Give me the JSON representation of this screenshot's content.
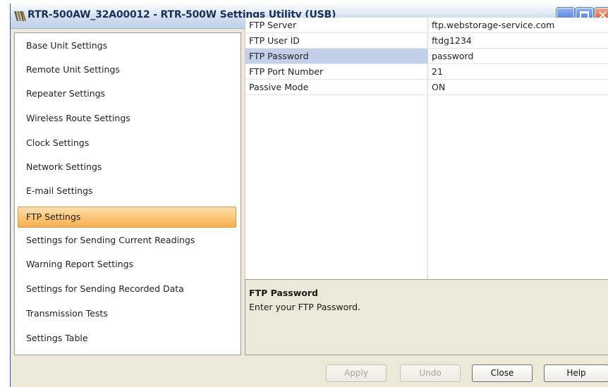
{
  "window": {
    "title": "RTR-500AW_32A00012 - RTR-500W Settings Utility (USB)",
    "controls": {
      "minimize": "minimize",
      "maximize": "maximize",
      "close_glyph": "✕"
    }
  },
  "sidebar": {
    "items": [
      {
        "label": "Base Unit Settings"
      },
      {
        "label": "Remote Unit Settings"
      },
      {
        "label": "Repeater Settings"
      },
      {
        "label": "Wireless Route Settings"
      },
      {
        "label": "Clock Settings"
      },
      {
        "label": "Network Settings"
      },
      {
        "label": "E-mail Settings"
      },
      {
        "label": "FTP Settings",
        "selected": true
      },
      {
        "label": "Settings for Sending Current Readings"
      },
      {
        "label": "Warning Report Settings"
      },
      {
        "label": "Settings for Sending Recorded Data"
      },
      {
        "label": "Transmission Tests"
      },
      {
        "label": "Settings Table"
      }
    ]
  },
  "grid": {
    "rows": [
      {
        "name": "FTP Server",
        "value": "ftp.webstorage-service.com"
      },
      {
        "name": "FTP User ID",
        "value": "ftdg1234"
      },
      {
        "name": "FTP Password",
        "value": "password",
        "selected": true
      },
      {
        "name": "FTP Port Number",
        "value": "21"
      },
      {
        "name": "Passive Mode",
        "value": "ON"
      }
    ]
  },
  "description": {
    "title": "FTP Password",
    "text": "Enter your FTP Password."
  },
  "buttons": {
    "apply": "Apply",
    "undo": "Undo",
    "close": "Close",
    "help": "Help"
  },
  "colors": {
    "selection_orange": "#f7ae51",
    "selection_blue": "#c2d0e9",
    "titlebar_text": "#1b2f58",
    "close_red": "#d5431d"
  }
}
